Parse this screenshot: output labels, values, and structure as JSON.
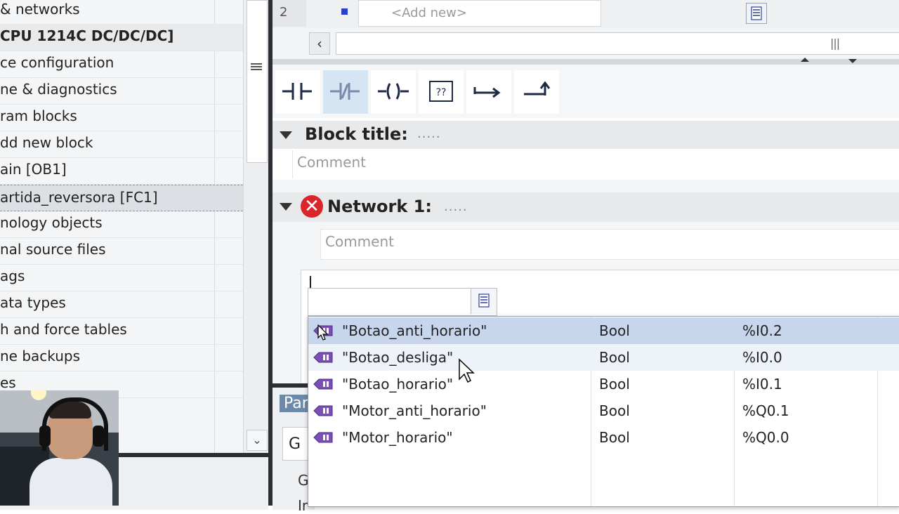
{
  "project_tree": {
    "items": [
      {
        "label": "& networks",
        "style": "normal"
      },
      {
        "label": "CPU 1214C DC/DC/DC]",
        "style": "bold"
      },
      {
        "label": "ce configuration",
        "style": "normal"
      },
      {
        "label": "ne & diagnostics",
        "style": "normal"
      },
      {
        "label": "ram blocks",
        "style": "normal"
      },
      {
        "label": "dd new block",
        "style": "normal"
      },
      {
        "label": "ain [OB1]",
        "style": "normal"
      },
      {
        "label": "artida_reversora [FC1]",
        "style": "selected"
      },
      {
        "label": "nology objects",
        "style": "normal"
      },
      {
        "label": "nal source files",
        "style": "normal"
      },
      {
        "label": "ags",
        "style": "normal"
      },
      {
        "label": "ata types",
        "style": "normal"
      },
      {
        "label": "h and force tables",
        "style": "normal"
      },
      {
        "label": "ne backups",
        "style": "normal"
      },
      {
        "label": "es",
        "style": "normal"
      }
    ]
  },
  "interface_table": {
    "row_number": "2",
    "add_new_placeholder": "<Add new>"
  },
  "ladder_toolbar": {
    "buttons": [
      {
        "name": "normally-open-contact",
        "active": false
      },
      {
        "name": "normally-closed-contact",
        "active": true
      },
      {
        "name": "output-coil",
        "active": false
      },
      {
        "name": "empty-box",
        "active": false
      },
      {
        "name": "open-branch",
        "active": false
      },
      {
        "name": "close-branch",
        "active": false
      }
    ]
  },
  "block": {
    "title_label": "Block title:",
    "title_value": ".....",
    "comment_placeholder": "Comment"
  },
  "network": {
    "label": "Network 1:",
    "title_value": ".....",
    "comment_placeholder": "Comment",
    "has_error": true
  },
  "inspector": {
    "tab_label": "Par",
    "general_tab": "G",
    "row2": "G",
    "row3": "Ir"
  },
  "tag_dropdown": {
    "input_value": "",
    "rows": [
      {
        "name": "\"Botao_anti_horario\"",
        "type": "Bool",
        "address": "%I0.2",
        "state": "selected"
      },
      {
        "name": "\"Botao_desliga\"",
        "type": "Bool",
        "address": "%I0.0",
        "state": "hover"
      },
      {
        "name": "\"Botao_horario\"",
        "type": "Bool",
        "address": "%I0.1",
        "state": "normal"
      },
      {
        "name": "\"Motor_anti_horario\"",
        "type": "Bool",
        "address": "%Q0.1",
        "state": "normal"
      },
      {
        "name": "\"Motor_horario\"",
        "type": "Bool",
        "address": "%Q0.0",
        "state": "normal"
      }
    ]
  },
  "colors": {
    "selection": "#c7d6ec",
    "error": "#d9262b",
    "tag_icon": "#6b3fa0"
  }
}
